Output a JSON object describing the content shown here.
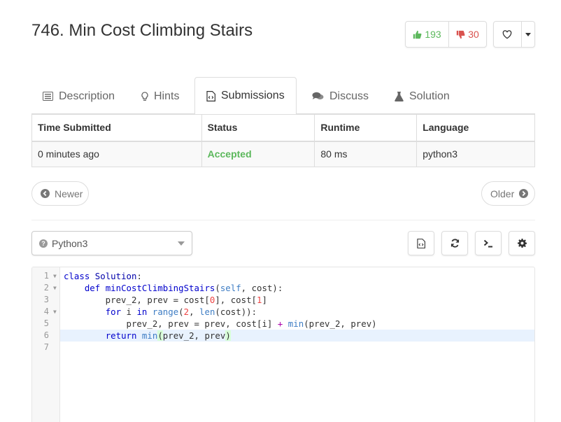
{
  "problem": {
    "title": "746. Min Cost Climbing Stairs",
    "upvotes": "193",
    "downvotes": "30"
  },
  "tabs": [
    {
      "label": "Description",
      "icon": "description-icon"
    },
    {
      "label": "Hints",
      "icon": "lightbulb-icon"
    },
    {
      "label": "Submissions",
      "icon": "code-file-icon",
      "active": true
    },
    {
      "label": "Discuss",
      "icon": "chat-icon"
    },
    {
      "label": "Solution",
      "icon": "flask-icon"
    }
  ],
  "submissions": {
    "headers": [
      "Time Submitted",
      "Status",
      "Runtime",
      "Language"
    ],
    "rows": [
      {
        "time": "0 minutes ago",
        "status": "Accepted",
        "runtime": "80 ms",
        "language": "python3"
      }
    ]
  },
  "pager": {
    "newer": "Newer",
    "older": "Older"
  },
  "editor": {
    "language": "Python3",
    "lines": [
      "1",
      "2",
      "3",
      "4",
      "5",
      "6",
      "7"
    ]
  },
  "colors": {
    "accepted": "#5cb85c",
    "downvote": "#d9534f",
    "highlight_line": "#e8f2fe"
  }
}
